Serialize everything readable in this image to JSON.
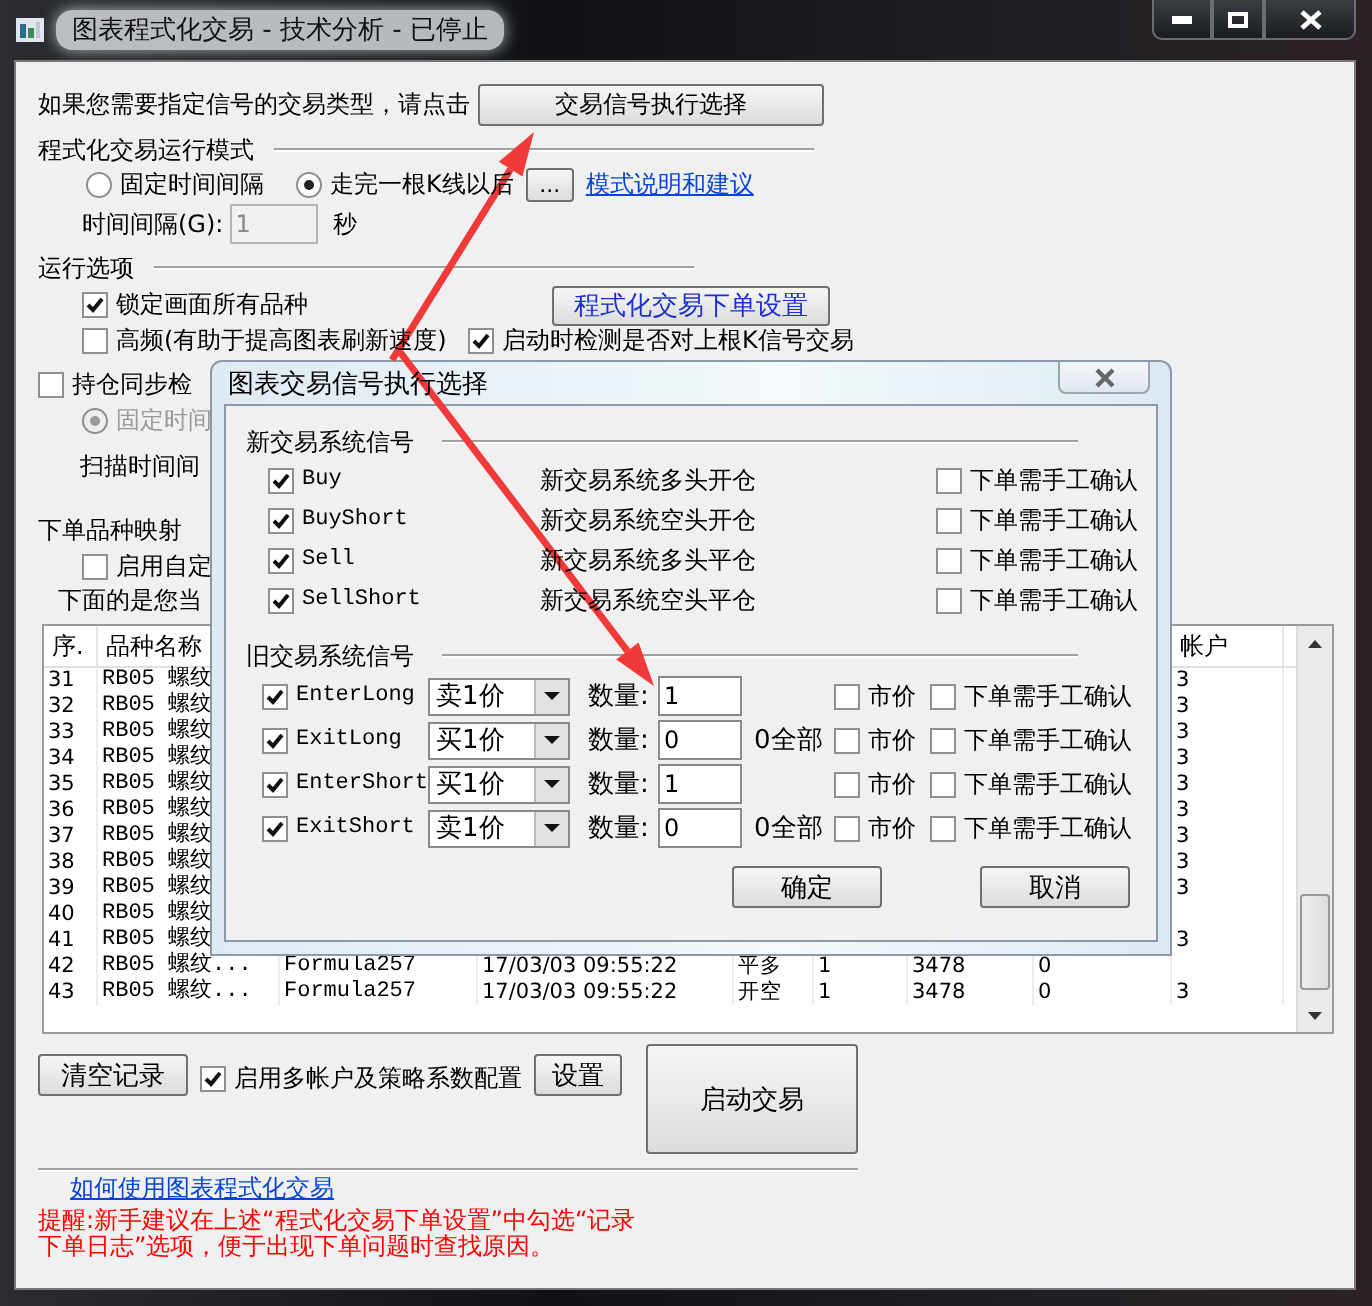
{
  "window": {
    "title": "图表程式化交易 - 技术分析 - 已停止"
  },
  "signal_prompt": {
    "text": "如果您需要指定信号的交易类型，请点击",
    "button": "交易信号执行选择"
  },
  "run_mode": {
    "heading": "程式化交易运行模式",
    "options": [
      {
        "label": "固定时间间隔",
        "selected": false
      },
      {
        "label": "走完一根K线以后",
        "selected": true
      }
    ],
    "more_button": "...",
    "link": "模式说明和建议",
    "interval_label": "时间间隔(G):",
    "interval_value": "1",
    "interval_disabled": true,
    "unit": "秒"
  },
  "run_options": {
    "heading": "运行选项",
    "settings_button": "程式化交易下单设置",
    "checkboxes": [
      {
        "label": "锁定画面所有品种",
        "checked": true
      },
      {
        "label": "高频(有助于提高图表刷新速度)",
        "checked": false
      },
      {
        "label": "启动时检测是否对上根K信号交易",
        "checked": true
      }
    ]
  },
  "position_sync": {
    "label": "持仓同步检",
    "checked": false,
    "radio_label": "固定时间",
    "radio_selected": true,
    "radio_disabled": true,
    "scan_label": "扫描时间间"
  },
  "mapping": {
    "heading": "下单品种映射",
    "checkbox": {
      "label": "启用自定",
      "checked": false
    },
    "note": "下面的是您当"
  },
  "table": {
    "columns": [
      "序.",
      "品种名称",
      null,
      null,
      null,
      null,
      null,
      null,
      "帐户"
    ],
    "rows": [
      [
        "31",
        "RB05 螺纹",
        null,
        null,
        null,
        null,
        null,
        null,
        "3"
      ],
      [
        "32",
        "RB05 螺纹",
        null,
        null,
        null,
        null,
        null,
        null,
        "3"
      ],
      [
        "33",
        "RB05 螺纹",
        null,
        null,
        null,
        null,
        null,
        null,
        "3"
      ],
      [
        "34",
        "RB05 螺纹",
        null,
        null,
        null,
        null,
        null,
        null,
        "3"
      ],
      [
        "35",
        "RB05 螺纹",
        null,
        null,
        null,
        null,
        null,
        null,
        "3"
      ],
      [
        "36",
        "RB05 螺纹",
        null,
        null,
        null,
        null,
        null,
        null,
        "3"
      ],
      [
        "37",
        "RB05 螺纹",
        null,
        null,
        null,
        null,
        null,
        null,
        "3"
      ],
      [
        "38",
        "RB05 螺纹",
        null,
        null,
        null,
        null,
        null,
        null,
        "3"
      ],
      [
        "39",
        "RB05 螺纹",
        null,
        null,
        null,
        null,
        null,
        null,
        "3"
      ],
      [
        "40",
        "RB05 螺纹",
        null,
        null,
        null,
        null,
        null,
        null,
        null
      ],
      [
        "41",
        "RB05 螺纹",
        null,
        null,
        null,
        null,
        null,
        null,
        "3"
      ],
      [
        "42",
        "RB05 螺纹...",
        "Formula257",
        "17/03/03 09:55:22",
        "平多",
        "1",
        "3478",
        "0",
        null
      ],
      [
        "43",
        "RB05 螺纹...",
        "Formula257",
        "17/03/03 09:55:22",
        "开空",
        "1",
        "3478",
        "0",
        "3"
      ]
    ]
  },
  "bottom": {
    "clear_button": "清空记录",
    "multi_account": {
      "label": "启用多帐户及策略系数配置",
      "checked": true
    },
    "settings_button": "设置",
    "start_button": "启动交易",
    "help_link": "如何使用图表程式化交易",
    "tip": "提醒:新手建议在上述“程式化交易下单设置”中勾选“记录下单日志”选项，便于出现下单问题时查找原因。"
  },
  "dialog": {
    "title": "图表交易信号执行选择",
    "new_signals": {
      "heading": "新交易系统信号",
      "rows": [
        {
          "name": "Buy",
          "checked": true,
          "description": "新交易系统多头开仓",
          "confirm_label": "下单需手工确认",
          "confirm_checked": false
        },
        {
          "name": "BuyShort",
          "checked": true,
          "description": "新交易系统空头开仓",
          "confirm_label": "下单需手工确认",
          "confirm_checked": false
        },
        {
          "name": "Sell",
          "checked": true,
          "description": "新交易系统多头平仓",
          "confirm_label": "下单需手工确认",
          "confirm_checked": false
        },
        {
          "name": "SellShort",
          "checked": true,
          "description": "新交易系统空头平仓",
          "confirm_label": "下单需手工确认",
          "confirm_checked": false
        }
      ]
    },
    "old_signals": {
      "heading": "旧交易系统信号",
      "rows": [
        {
          "name": "EnterLong",
          "checked": true,
          "price": "卖1价",
          "qty_label": "数量:",
          "qty": "1",
          "market_label": "市价",
          "market_checked": false,
          "confirm_label": "下单需手工确认",
          "confirm_checked": false
        },
        {
          "name": "ExitLong",
          "checked": true,
          "price": "买1价",
          "qty_label": "数量:",
          "qty": "0",
          "note": "0全部",
          "market_label": "市价",
          "market_checked": false,
          "confirm_label": "下单需手工确认",
          "confirm_checked": false
        },
        {
          "name": "EnterShort",
          "checked": true,
          "price": "买1价",
          "qty_label": "数量:",
          "qty": "1",
          "market_label": "市价",
          "market_checked": false,
          "confirm_label": "下单需手工确认",
          "confirm_checked": false
        },
        {
          "name": "ExitShort",
          "checked": true,
          "price": "卖1价",
          "qty_label": "数量:",
          "qty": "0",
          "note": "0全部",
          "market_label": "市价",
          "market_checked": false,
          "confirm_label": "下单需手工确认",
          "confirm_checked": false
        }
      ]
    },
    "ok_button": "确定",
    "cancel_button": "取消"
  }
}
